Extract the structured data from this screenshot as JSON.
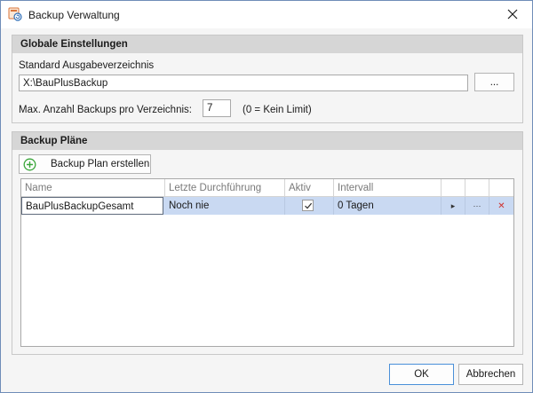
{
  "window": {
    "title": "Backup Verwaltung",
    "close_glyph": "✕"
  },
  "global": {
    "header": "Globale Einstellungen",
    "output_dir_label": "Standard Ausgabeverzeichnis",
    "output_dir_value": "X:\\BauPlusBackup",
    "browse_label": "...",
    "max_backups_label": "Max. Anzahl Backups pro Verzeichnis:",
    "max_backups_value": "7",
    "max_backups_hint": "(0 = Kein Limit)"
  },
  "plans": {
    "header": "Backup Pläne",
    "create_label": "Backup Plan erstellen",
    "columns": [
      "Name",
      "Letzte Durchführung",
      "Aktiv",
      "Intervall"
    ],
    "rows": [
      {
        "name": "BauPlusBackupGesamt",
        "last_run": "Noch nie",
        "active": true,
        "interval": "0 Tagen",
        "run_glyph": "▸",
        "more_glyph": "···",
        "delete_glyph": "✕"
      }
    ]
  },
  "footer": {
    "ok_label": "OK",
    "cancel_label": "Abbrechen"
  },
  "colors": {
    "header_bg": "#d6d6d6",
    "selected_row": "#c9d9f2",
    "plus_icon": "#3aa63a",
    "delete_icon": "#d0312d",
    "window_border": "#6f8db8"
  }
}
